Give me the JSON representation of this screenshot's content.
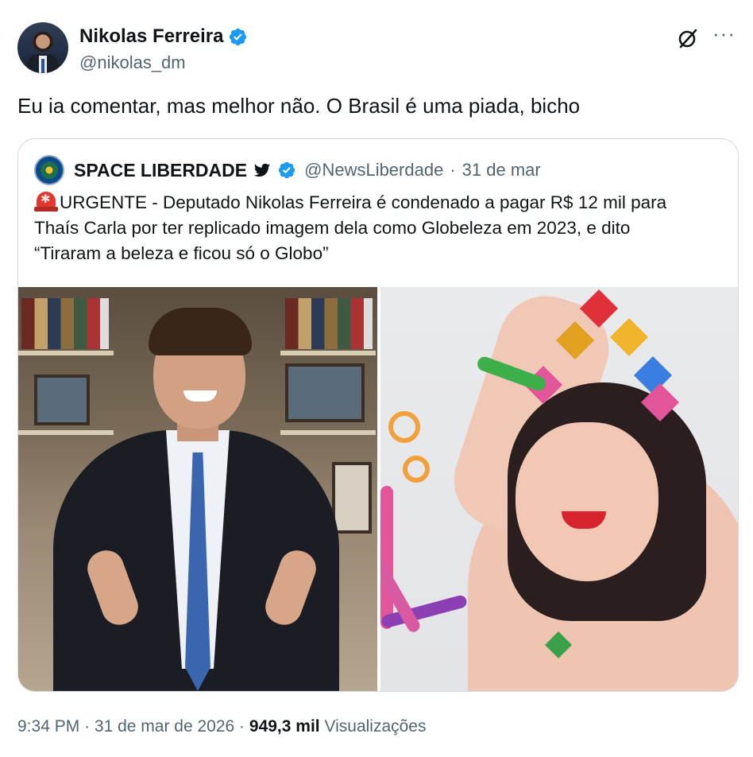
{
  "author": {
    "name": "Nikolas Ferreira",
    "handle": "@nikolas_dm",
    "verified_color": "#1d9bf0"
  },
  "icons": {
    "grok": "grok-icon",
    "more": "more-icon",
    "more_glyph": "···"
  },
  "tweet": {
    "text": "Eu ia comentar, mas melhor não. O Brasil é uma piada, bicho"
  },
  "quoted": {
    "name": "SPACE LIBERDADE",
    "handle": "@NewsLiberdade",
    "separator": "·",
    "date": "31 de mar",
    "lines": [
      "URGENTE - Deputado Nikolas Ferreira é condenado a pagar R$ 12 mil para",
      "Thaís Carla por ter replicado imagem dela como Globeleza em 2023, e dito",
      "“Tiraram a beleza e ficou só o Globo”"
    ]
  },
  "meta": {
    "time": "9:34 PM",
    "separator1": "·",
    "date": "31 de mar de 2026",
    "separator2": "·",
    "views_count": "949,3 mil",
    "views_label": "Visualizações"
  }
}
